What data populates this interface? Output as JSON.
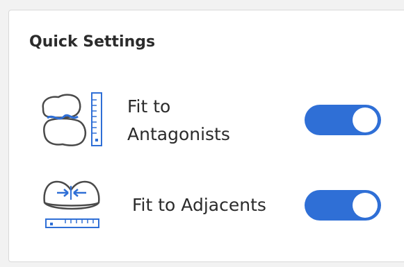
{
  "quick_settings": {
    "title": "Quick Settings",
    "items": [
      {
        "label_line1": "Fit to",
        "label_line2": "Antagonists",
        "icon": "antagonists-icon",
        "enabled": true
      },
      {
        "label": "Fit to Adjacents",
        "icon": "adjacents-icon",
        "enabled": true
      }
    ]
  },
  "colors": {
    "toggle_on": "#2f6fd6",
    "icon_accent": "#2f6fd6",
    "icon_stroke": "#4a4a4a"
  }
}
